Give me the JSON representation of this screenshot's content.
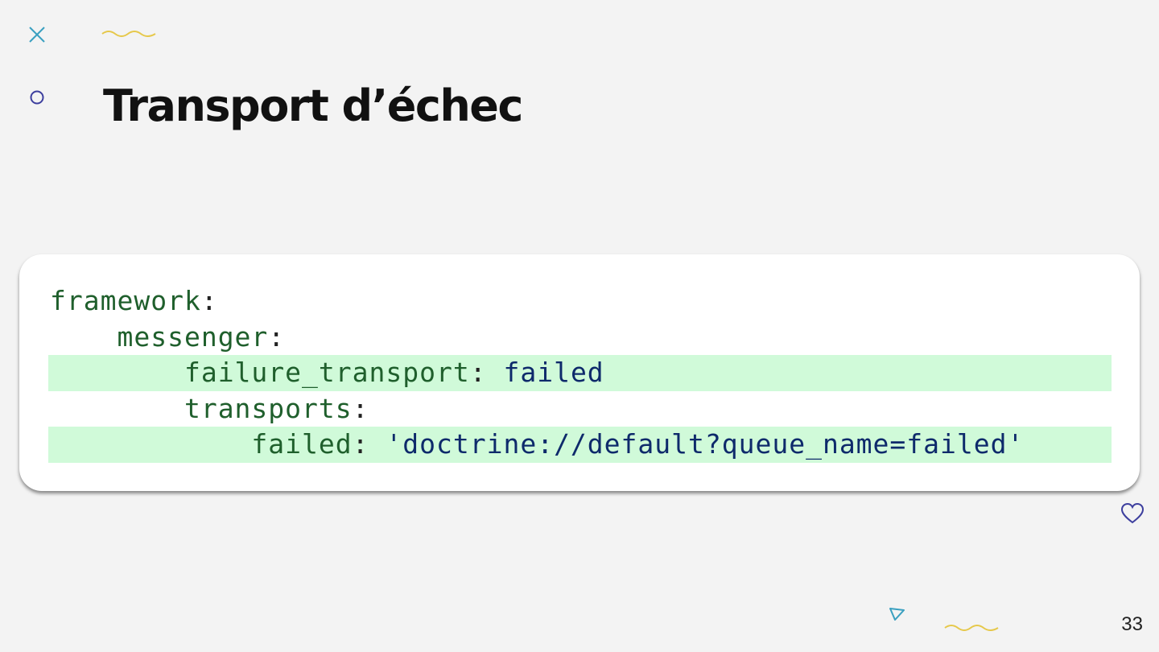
{
  "slide": {
    "title": "Transport d’échec",
    "page_number": "33"
  },
  "code": {
    "language": "yaml",
    "lines": [
      {
        "indent": "",
        "key": "framework",
        "sep": ":",
        "value": "",
        "highlighted": false
      },
      {
        "indent": "    ",
        "key": "messenger",
        "sep": ":",
        "value": "",
        "highlighted": false
      },
      {
        "indent": "        ",
        "key": "failure_transport",
        "sep": ": ",
        "value": "failed",
        "highlighted": true
      },
      {
        "indent": "        ",
        "key": "transports",
        "sep": ":",
        "value": "",
        "highlighted": false
      },
      {
        "indent": "            ",
        "key": "failed",
        "sep": ": ",
        "value": "'doctrine://default?queue_name=failed'",
        "highlighted": true
      }
    ]
  },
  "colors": {
    "background": "#f3f3f3",
    "highlight": "#d0fad9",
    "yaml_key": "#1f5f2c",
    "yaml_value": "#0e2a6b",
    "deco_teal": "#3aa0c0",
    "deco_yellow": "#e6c84a",
    "deco_indigo": "#3d3f9e"
  },
  "decorations": [
    "cross-icon",
    "squiggle-icon",
    "circle-icon",
    "heart-icon",
    "triangle-icon",
    "squiggle-icon"
  ]
}
